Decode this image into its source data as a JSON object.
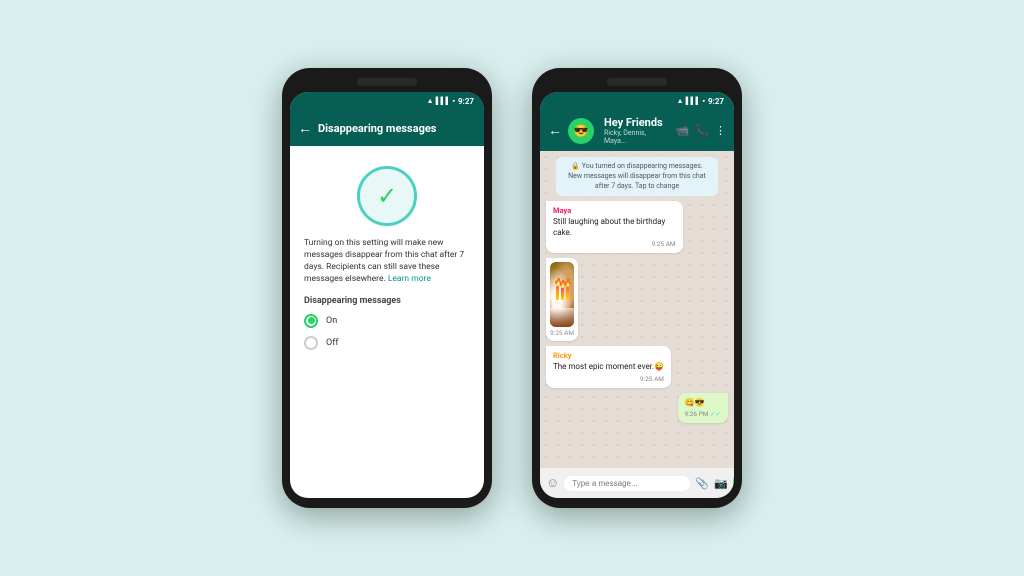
{
  "background_color": "#d8f0ee",
  "phone1": {
    "status_bar": {
      "time": "9:27"
    },
    "app_bar": {
      "back_label": "←",
      "title": "Disappearing messages"
    },
    "description": "Turning on this setting will make new messages disappear from this chat after 7 days. Recipients can still save these messages elsewhere.",
    "learn_more": "Learn more",
    "setting_label": "Disappearing messages",
    "options": [
      {
        "label": "On",
        "selected": true
      },
      {
        "label": "Off",
        "selected": false
      }
    ]
  },
  "phone2": {
    "status_bar": {
      "time": "9:27"
    },
    "app_bar": {
      "back_label": "←",
      "title": "Hey Friends",
      "subtitle": "Ricky, Dennis, Maya...",
      "emoji": "😎"
    },
    "system_message": "🔒 You turned on disappearing messages. New messages will disappear from this chat after 7 days. Tap to change",
    "messages": [
      {
        "type": "left",
        "sender": "Maya",
        "sender_color": "pink",
        "text": "Still laughing about the birthday cake.",
        "time": "9:25 AM"
      },
      {
        "type": "image",
        "time": "9:25 AM",
        "alt": "Birthday cake photo"
      },
      {
        "type": "left",
        "sender": "Ricky",
        "sender_color": "orange",
        "text": "The most epic moment ever.😜",
        "time": "9:25 AM"
      },
      {
        "type": "right",
        "text": "😋😎",
        "time": "9:26 PM",
        "ticks": "✓✓"
      }
    ],
    "input_placeholder": "Type a message..."
  }
}
